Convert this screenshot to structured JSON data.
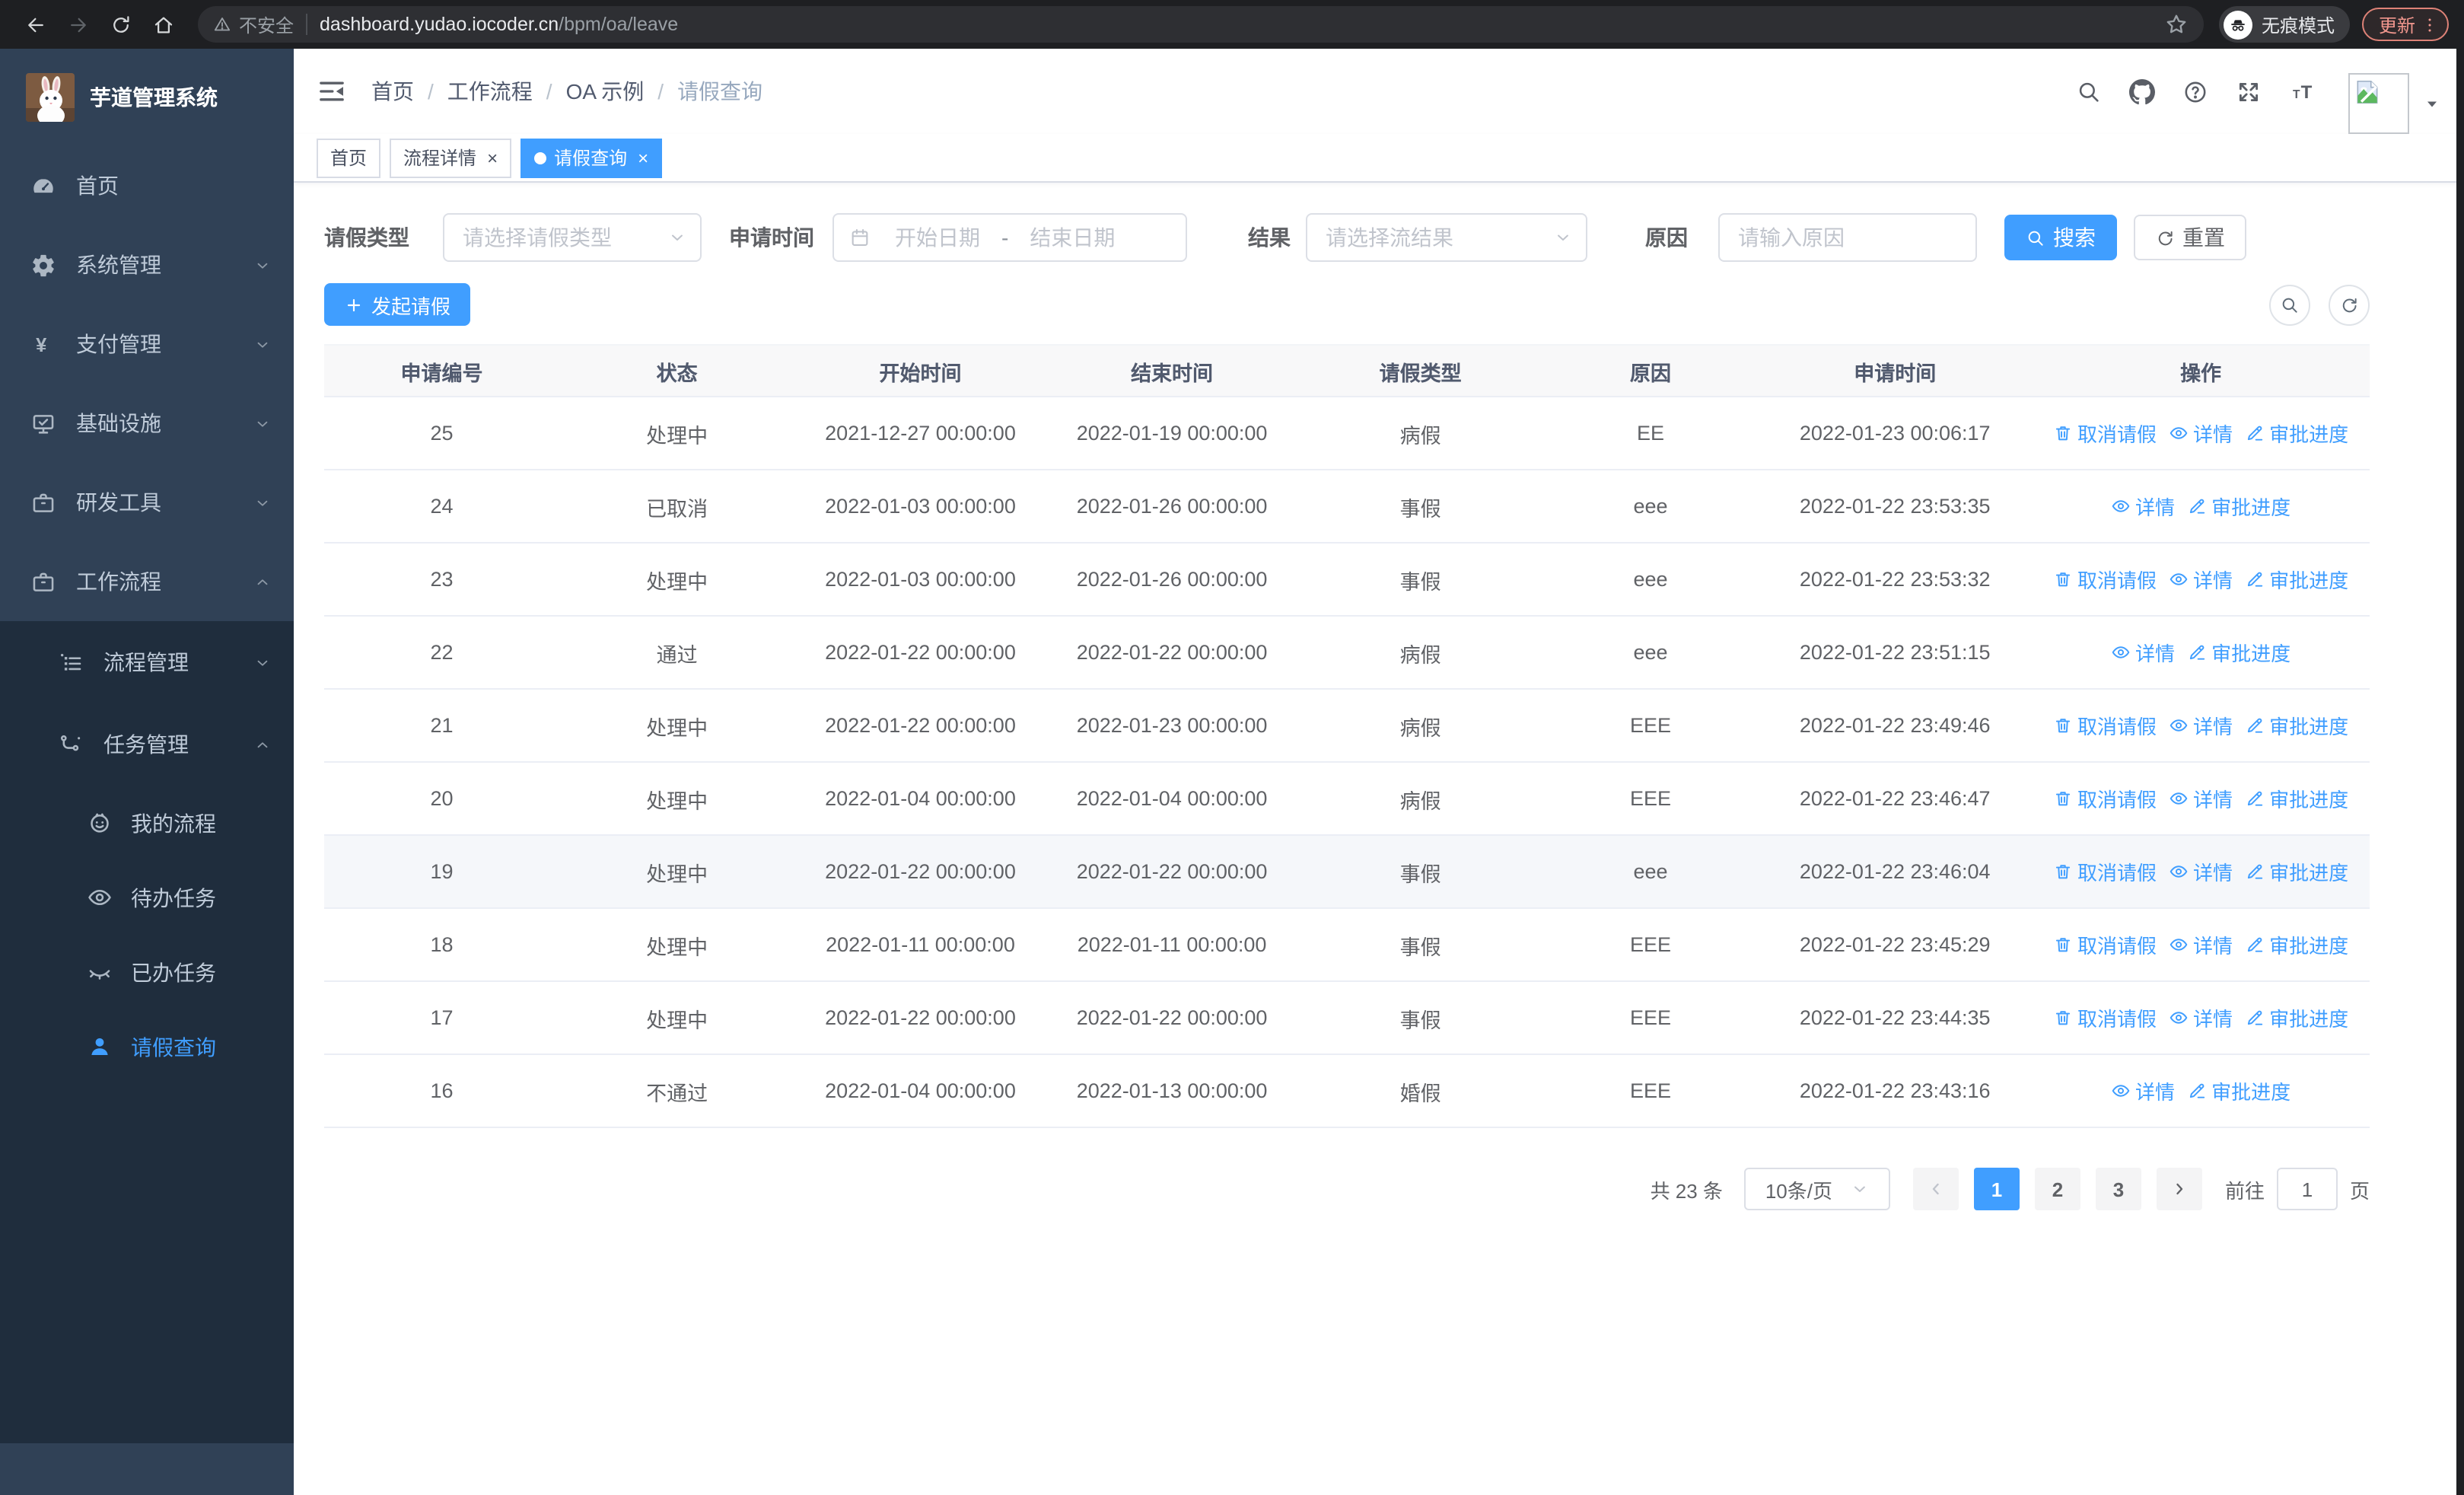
{
  "colors": {
    "primary": "#409eff",
    "sidebar_bg": "#304156",
    "submenu_bg": "#1f2d3d",
    "active_text": "#409eff",
    "chrome_bg": "#1e1f22",
    "update_accent": "#f0968d"
  },
  "browser": {
    "security_label": "不安全",
    "url_host": "dashboard.yudao.iocoder.cn",
    "url_path": "/bpm/oa/leave",
    "incognito_label": "无痕模式",
    "update_label": "更新"
  },
  "sidebar": {
    "title": "芋道管理系统",
    "menu": [
      {
        "label": "首页",
        "icon": "dashboard-icon"
      },
      {
        "label": "系统管理",
        "icon": "gear-icon",
        "chevron": "down"
      },
      {
        "label": "支付管理",
        "icon": "yen-icon",
        "chevron": "down"
      },
      {
        "label": "基础设施",
        "icon": "monitor-icon",
        "chevron": "down"
      },
      {
        "label": "研发工具",
        "icon": "toolbox-icon",
        "chevron": "down"
      },
      {
        "label": "工作流程",
        "icon": "briefcase-icon",
        "chevron": "up"
      }
    ],
    "submenu": [
      {
        "label": "流程管理",
        "icon": "list-tree-icon",
        "chevron": "down",
        "level": 1
      },
      {
        "label": "任务管理",
        "icon": "flow-icon",
        "chevron": "up",
        "level": 1
      },
      {
        "label": "我的流程",
        "icon": "face-icon",
        "level": 2
      },
      {
        "label": "待办任务",
        "icon": "eye-open-icon",
        "level": 2
      },
      {
        "label": "已办任务",
        "icon": "eye-closed-icon",
        "level": 2
      },
      {
        "label": "请假查询",
        "icon": "user-icon",
        "level": 2,
        "active": true
      }
    ]
  },
  "header": {
    "breadcrumbs": [
      "首页",
      "工作流程",
      "OA 示例",
      "请假查询"
    ],
    "breadcrumb_separator": "/"
  },
  "tabs": [
    {
      "label": "首页",
      "closable": false,
      "active": false
    },
    {
      "label": "流程详情",
      "closable": true,
      "active": false
    },
    {
      "label": "请假查询",
      "closable": true,
      "active": true
    }
  ],
  "filters": {
    "leave_type_label": "请假类型",
    "leave_type_placeholder": "请选择请假类型",
    "apply_time_label": "申请时间",
    "date_start_placeholder": "开始日期",
    "date_separator": "-",
    "date_end_placeholder": "结束日期",
    "result_label": "结果",
    "result_placeholder": "请选择流结果",
    "reason_label": "原因",
    "reason_placeholder": "请输入原因",
    "search_label": "搜索",
    "reset_label": "重置"
  },
  "toolbar": {
    "create_label": "发起请假"
  },
  "table": {
    "columns": [
      "申请编号",
      "状态",
      "开始时间",
      "结束时间",
      "请假类型",
      "原因",
      "申请时间",
      "操作"
    ],
    "action_labels": {
      "cancel": "取消请假",
      "detail": "详情",
      "progress": "审批进度"
    },
    "rows": [
      {
        "id": "25",
        "status": "处理中",
        "start": "2021-12-27 00:00:00",
        "end": "2022-01-19 00:00:00",
        "type": "病假",
        "reason": "EE",
        "applied": "2022-01-23 00:06:17",
        "actions": [
          "cancel",
          "detail",
          "progress"
        ]
      },
      {
        "id": "24",
        "status": "已取消",
        "start": "2022-01-03 00:00:00",
        "end": "2022-01-26 00:00:00",
        "type": "事假",
        "reason": "eee",
        "applied": "2022-01-22 23:53:35",
        "actions": [
          "detail",
          "progress"
        ]
      },
      {
        "id": "23",
        "status": "处理中",
        "start": "2022-01-03 00:00:00",
        "end": "2022-01-26 00:00:00",
        "type": "事假",
        "reason": "eee",
        "applied": "2022-01-22 23:53:32",
        "actions": [
          "cancel",
          "detail",
          "progress"
        ]
      },
      {
        "id": "22",
        "status": "通过",
        "start": "2022-01-22 00:00:00",
        "end": "2022-01-22 00:00:00",
        "type": "病假",
        "reason": "eee",
        "applied": "2022-01-22 23:51:15",
        "actions": [
          "detail",
          "progress"
        ]
      },
      {
        "id": "21",
        "status": "处理中",
        "start": "2022-01-22 00:00:00",
        "end": "2022-01-23 00:00:00",
        "type": "病假",
        "reason": "EEE",
        "applied": "2022-01-22 23:49:46",
        "actions": [
          "cancel",
          "detail",
          "progress"
        ]
      },
      {
        "id": "20",
        "status": "处理中",
        "start": "2022-01-04 00:00:00",
        "end": "2022-01-04 00:00:00",
        "type": "病假",
        "reason": "EEE",
        "applied": "2022-01-22 23:46:47",
        "actions": [
          "cancel",
          "detail",
          "progress"
        ]
      },
      {
        "id": "19",
        "status": "处理中",
        "start": "2022-01-22 00:00:00",
        "end": "2022-01-22 00:00:00",
        "type": "事假",
        "reason": "eee",
        "applied": "2022-01-22 23:46:04",
        "actions": [
          "cancel",
          "detail",
          "progress"
        ],
        "highlighted": true
      },
      {
        "id": "18",
        "status": "处理中",
        "start": "2022-01-11 00:00:00",
        "end": "2022-01-11 00:00:00",
        "type": "事假",
        "reason": "EEE",
        "applied": "2022-01-22 23:45:29",
        "actions": [
          "cancel",
          "detail",
          "progress"
        ]
      },
      {
        "id": "17",
        "status": "处理中",
        "start": "2022-01-22 00:00:00",
        "end": "2022-01-22 00:00:00",
        "type": "事假",
        "reason": "EEE",
        "applied": "2022-01-22 23:44:35",
        "actions": [
          "cancel",
          "detail",
          "progress"
        ]
      },
      {
        "id": "16",
        "status": "不通过",
        "start": "2022-01-04 00:00:00",
        "end": "2022-01-13 00:00:00",
        "type": "婚假",
        "reason": "EEE",
        "applied": "2022-01-22 23:43:16",
        "actions": [
          "detail",
          "progress"
        ]
      }
    ]
  },
  "pagination": {
    "total": "共 23 条",
    "page_size": "10条/页",
    "pages": [
      "1",
      "2",
      "3"
    ],
    "active_page": "1",
    "goto_label": "前往",
    "goto_value": "1",
    "goto_unit": "页"
  }
}
